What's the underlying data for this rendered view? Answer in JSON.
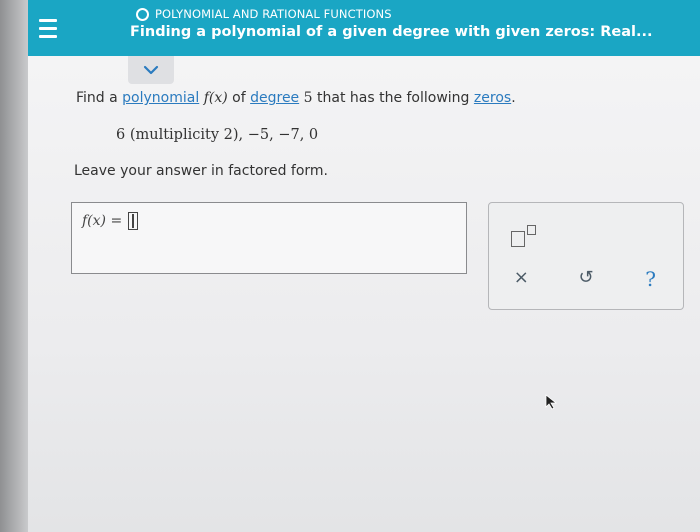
{
  "header": {
    "topic": "POLYNOMIAL AND RATIONAL FUNCTIONS",
    "title": "Finding a polynomial of a given degree with given zeros: Real..."
  },
  "problem": {
    "find_a": "Find a",
    "polynomial_link": "polynomial",
    "function_name": "f(x)",
    "of_text": "of",
    "degree_link": "degree",
    "degree_value": "5",
    "that_has_text": "that has the following",
    "zeros_link": "zeros",
    "period": ".",
    "zeros_list": "6 (multiplicity 2),  −5,  −7,  0",
    "instruction": "Leave your answer in factored form."
  },
  "answer": {
    "label": "f(x) ="
  },
  "tools": {
    "clear_symbol": "×",
    "undo_symbol": "↺",
    "help_symbol": "?"
  },
  "colors": {
    "header_bg": "#1aa6c4",
    "link": "#2b7bbf"
  }
}
